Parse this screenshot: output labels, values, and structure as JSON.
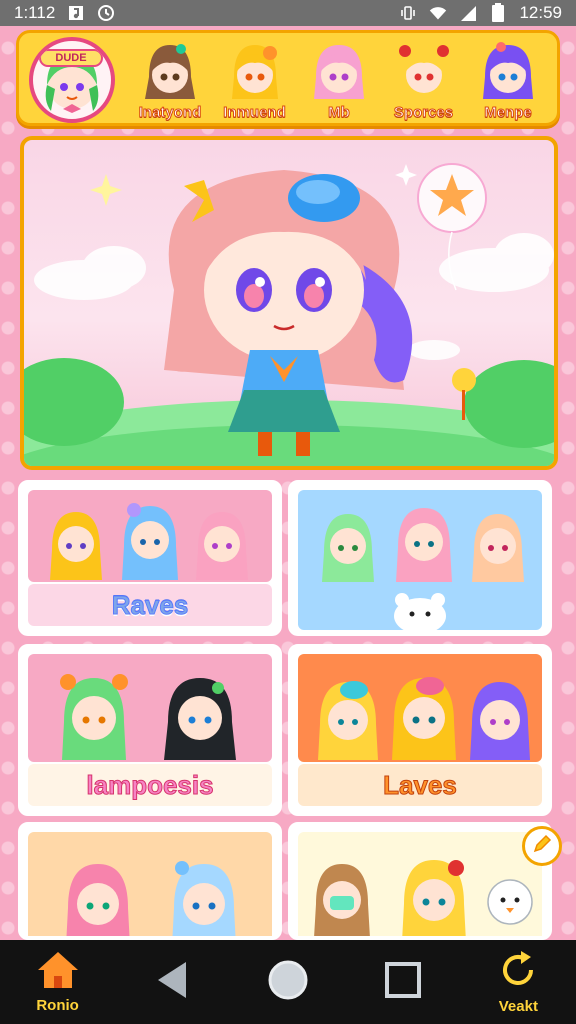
{
  "status_bar": {
    "time_left": "1:112",
    "time_right": "12:59",
    "icons": [
      "music-icon",
      "clock-icon",
      "vibrate-icon",
      "wifi-icon",
      "signal-icon",
      "battery-icon"
    ]
  },
  "top_strip": {
    "avatar_banner": "DUDE",
    "characters": [
      {
        "label": "Inatyond",
        "hair": "#8a5a3b"
      },
      {
        "label": "Inmuend",
        "hair": "#ffd43b"
      },
      {
        "label": "Mb",
        "hair": "#f7a1d0"
      },
      {
        "label": "Sporces",
        "hair": "#ffd43b"
      },
      {
        "label": "Menpe",
        "hair": "#7950f2"
      }
    ]
  },
  "cards": [
    {
      "caption": "Raves",
      "style": "blue"
    },
    {
      "caption": "",
      "style": "sky"
    },
    {
      "caption": "lampoesis",
      "style": "pink"
    },
    {
      "caption": "Laves",
      "style": "orange"
    },
    {
      "caption": "",
      "style": "peach"
    },
    {
      "caption": "",
      "style": "cream"
    }
  ],
  "nav": {
    "home_label": "Ronio",
    "right_label": "Veakt"
  },
  "colors": {
    "accent": "#f3a400",
    "nav_text": "#ffd43b",
    "background": "#f7a9c4"
  }
}
